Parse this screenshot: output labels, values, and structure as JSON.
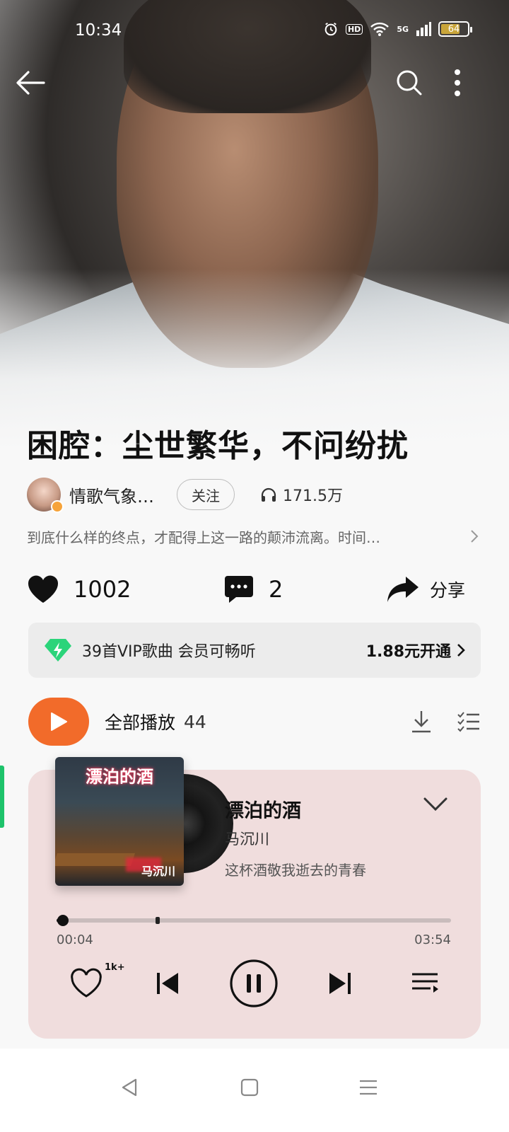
{
  "status_bar": {
    "time": "10:34",
    "signal_label": "5G",
    "hd_label": "HD",
    "battery_level": "64"
  },
  "header": {
    "back_icon": "back-arrow-icon",
    "search_icon": "search-icon",
    "more_icon": "more-vertical-icon"
  },
  "playlist": {
    "title": "困腔：尘世繁华，不问纷扰",
    "author": "情歌气象…",
    "follow_label": "关注",
    "play_count": "171.5万",
    "description": "到底什么样的终点，才配得上这一路的颠沛流离。时间…"
  },
  "actions": {
    "likes": "1002",
    "comments": "2",
    "share_label": "分享"
  },
  "vip_banner": {
    "label": "39首VIP歌曲 会员可畅听",
    "cta": "1.88元开通"
  },
  "play_all": {
    "label": "全部播放",
    "count": "44"
  },
  "player": {
    "cover_title": "漂泊的酒",
    "cover_signature": "马沉川",
    "song_title": "漂泊的酒",
    "artist": "马沉川",
    "subtitle": "这杯酒敬我逝去的青春",
    "current_time": "00:04",
    "total_time": "03:54",
    "progress_fraction": 0.017,
    "buffer_fraction": 0.25,
    "like_count": "1k+"
  },
  "colors": {
    "accent": "#f26b2a",
    "card": "#f0dddd",
    "vip_green": "#2bd47a",
    "indicator": "#1ec36b"
  }
}
